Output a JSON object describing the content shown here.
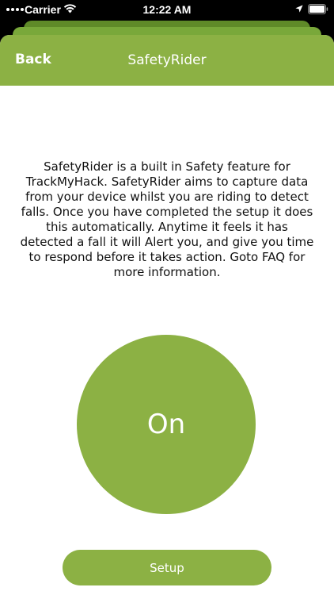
{
  "status_bar": {
    "carrier": "Carrier",
    "time": "12:22 AM",
    "icons": [
      "signal-dots-icon",
      "wifi-icon",
      "location-arrow-icon",
      "battery-icon"
    ]
  },
  "nav": {
    "back_label": "Back",
    "title": "SafetyRider"
  },
  "main": {
    "description": "SafetyRider is a built in Safety feature for TrackMyHack. SafetyRider aims to capture data from your device whilst you are riding to detect falls. Once you have completed the setup it does this automatically. Anytime it feels it has detected a fall it will Alert you, and give you time to respond before it takes action. Goto FAQ for more information.",
    "toggle_label": "On",
    "setup_label": "Setup"
  },
  "colors": {
    "accent": "#8cb144",
    "status_bar_background": "#000000",
    "background": "#ffffff"
  }
}
